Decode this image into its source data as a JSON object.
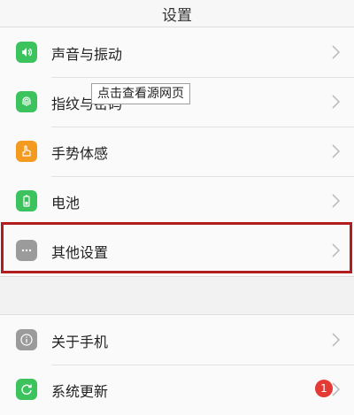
{
  "header": {
    "title": "设置"
  },
  "settings_group_1": [
    {
      "label": "声音与振动",
      "icon": "sound-icon"
    },
    {
      "label": "指纹与密码",
      "icon": "fingerprint-icon"
    },
    {
      "label": "手势体感",
      "icon": "gesture-icon"
    },
    {
      "label": "电池",
      "icon": "battery-icon"
    },
    {
      "label": "其他设置",
      "icon": "more-icon"
    }
  ],
  "settings_group_2": [
    {
      "label": "关于手机",
      "icon": "info-icon"
    },
    {
      "label": "系统更新",
      "icon": "update-icon",
      "badge": "1"
    }
  ],
  "tooltip": {
    "text": "点击查看源网页"
  },
  "colors": {
    "highlight": "#b21d1d",
    "green_icon": "#3cc35e",
    "orange_icon": "#f39a20",
    "gray_icon": "#9b9b9b",
    "badge": "#e53935"
  }
}
